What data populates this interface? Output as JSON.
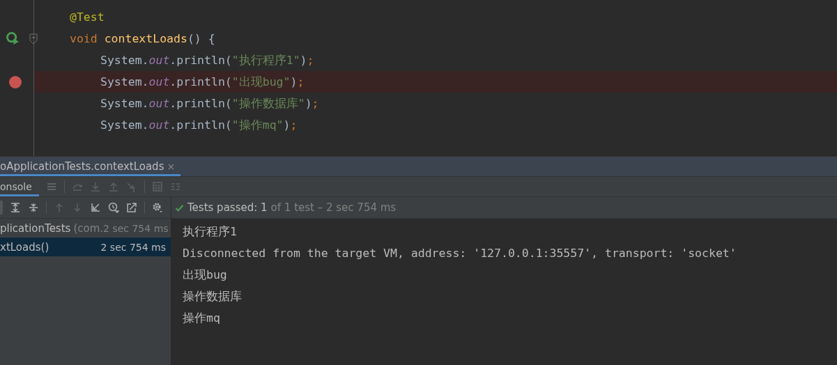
{
  "editor": {
    "lines": [
      {
        "kind": "plain",
        "fold": false,
        "highlighted": false,
        "tokens": [
          {
            "kind": "annotation",
            "text": "@Test"
          }
        ]
      },
      {
        "kind": "run",
        "fold": true,
        "highlighted": false,
        "tokens": [
          {
            "kind": "keyword",
            "text": "void "
          },
          {
            "kind": "method",
            "text": "contextLoads"
          },
          {
            "kind": "plain",
            "text": "() {"
          }
        ],
        "children": [
          {
            "kind": "plain",
            "fold": false,
            "highlighted": false,
            "tokens": [
              {
                "kind": "plain",
                "text": "System."
              },
              {
                "kind": "field",
                "text": "out"
              },
              {
                "kind": "plain",
                "text": ".println("
              },
              {
                "kind": "string",
                "text": "\"执行程序1\""
              },
              {
                "kind": "plain",
                "text": ")"
              },
              {
                "kind": "punct",
                "text": ";"
              }
            ]
          },
          {
            "kind": "breakpoint",
            "fold": false,
            "highlighted": true,
            "tokens": [
              {
                "kind": "plain",
                "text": "System."
              },
              {
                "kind": "field",
                "text": "out"
              },
              {
                "kind": "plain",
                "text": ".println("
              },
              {
                "kind": "string",
                "text": "\"出现bug\""
              },
              {
                "kind": "plain",
                "text": ")"
              },
              {
                "kind": "punct",
                "text": ";"
              }
            ]
          },
          {
            "kind": "plain",
            "fold": false,
            "highlighted": false,
            "tokens": [
              {
                "kind": "plain",
                "text": "System."
              },
              {
                "kind": "field",
                "text": "out"
              },
              {
                "kind": "plain",
                "text": ".println("
              },
              {
                "kind": "string",
                "text": "\"操作数据库\""
              },
              {
                "kind": "plain",
                "text": ")"
              },
              {
                "kind": "punct",
                "text": ";"
              }
            ]
          },
          {
            "kind": "plain",
            "fold": false,
            "highlighted": false,
            "tokens": [
              {
                "kind": "plain",
                "text": "System."
              },
              {
                "kind": "field",
                "text": "out"
              },
              {
                "kind": "plain",
                "text": ".println("
              },
              {
                "kind": "string",
                "text": "\"操作mq\""
              },
              {
                "kind": "plain",
                "text": ")"
              },
              {
                "kind": "punct",
                "text": ";"
              }
            ]
          }
        ]
      }
    ]
  },
  "run_tabs": [
    {
      "label": "oApplicationTests.contextLoads",
      "selected": true,
      "close": "×"
    }
  ],
  "sub_tabs": [
    {
      "label": "onsole",
      "selected": true
    }
  ],
  "status": {
    "passed": "Tests passed: 1",
    "detail": "of 1 test – 2 sec 754 ms"
  },
  "tree": [
    {
      "label": "plicationTests",
      "package": "(com.",
      "time": "2 sec 754 ms",
      "selected": false
    },
    {
      "label": "xtLoads()",
      "time": "2 sec 754 ms",
      "selected": true
    }
  ],
  "console": [
    "执行程序1",
    "Disconnected from the target VM, address: '127.0.0.1:35557', transport: 'socket'",
    "出现bug",
    "操作数据库",
    "操作mq"
  ]
}
